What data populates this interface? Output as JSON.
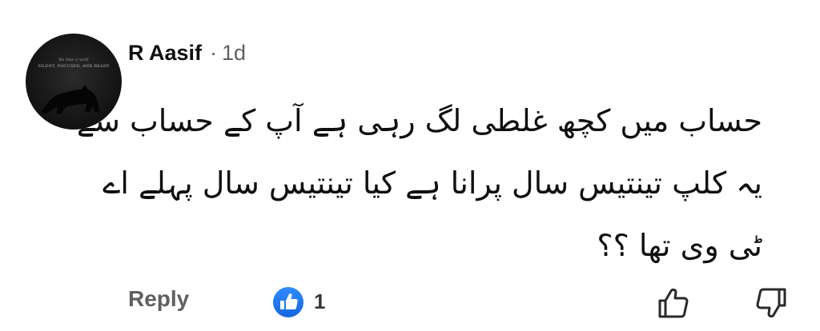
{
  "comment": {
    "avatar": {
      "line1": "Be like a wolf",
      "line2": "SILENT, FOCUSED, AND READY"
    },
    "author": "R Aasif",
    "separator": "·",
    "time": "1d",
    "text_lines": [
      "حساب میں کچھ غلطی لگ رہی ہے آپ کے حساب سے",
      "یہ کلپ تینتیس سال پرانا ہے کیا تینتیس سال پہلے اے",
      "ٹی وی تھا ؟؟"
    ]
  },
  "actions": {
    "reply_label": "Reply",
    "like_count": "1",
    "like_badge_color": "#1877f2",
    "icons": [
      "like-badge-icon",
      "thumb-up-icon",
      "thumb-down-icon"
    ]
  }
}
